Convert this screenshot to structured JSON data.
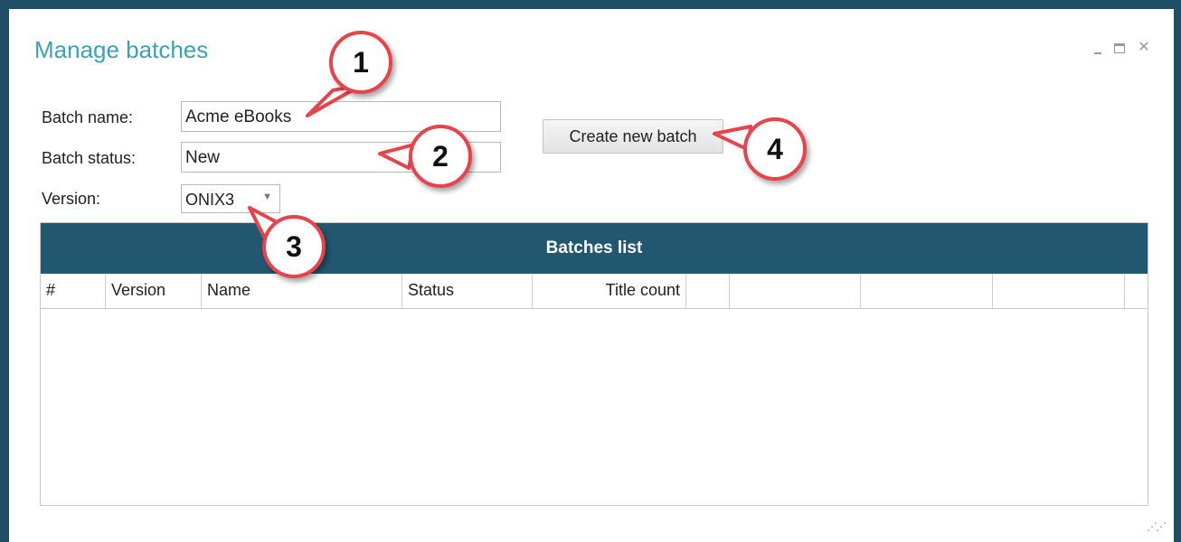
{
  "window": {
    "title": "Manage batches",
    "controls": {
      "minimize": "–",
      "maximize": "□",
      "close": "✕"
    }
  },
  "form": {
    "batch_name_label": "Batch name:",
    "batch_name_value": "Acme eBooks",
    "batch_status_label": "Batch status:",
    "batch_status_value": "New",
    "version_label": "Version:",
    "version_value": "ONIX3"
  },
  "actions": {
    "create_label": "Create new batch"
  },
  "grid": {
    "title": "Batches list",
    "columns": [
      "#",
      "Version",
      "Name",
      "Status",
      "Title count",
      "",
      "",
      "",
      "",
      ""
    ],
    "rows": []
  },
  "callouts": [
    "1",
    "2",
    "3",
    "4"
  ],
  "colors": {
    "accent": "#3aa3b3",
    "header": "#22586f",
    "callout_border": "#e8424a"
  }
}
